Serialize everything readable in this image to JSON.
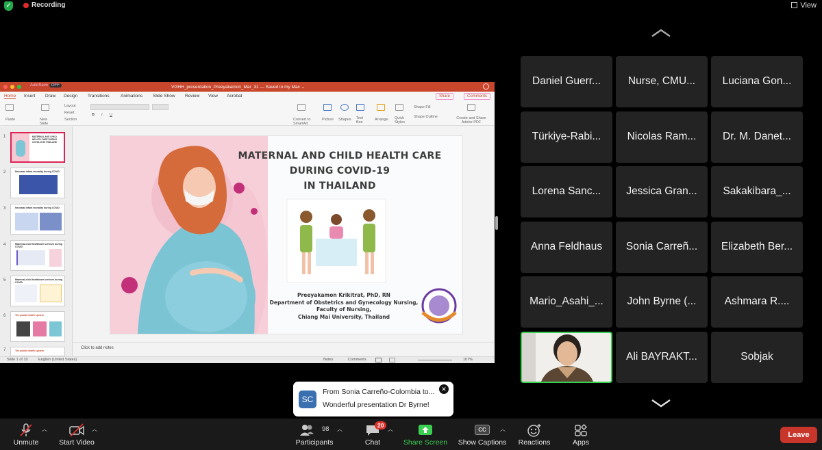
{
  "top_bar": {
    "recording_label": "Recording",
    "view_label": "View"
  },
  "shared_app": {
    "window_title": "VGHH_presentation_Preeyakamon_Mar_31 — Saved to my Mac ⌄",
    "autosave_label": "AutoSave",
    "autosave_state": "OFF",
    "ribbon_tabs": [
      "Home",
      "Insert",
      "Draw",
      "Design",
      "Transitions",
      "Animations",
      "Slide Show",
      "Review",
      "View",
      "Acrobat"
    ],
    "share_label": "Share",
    "comments_label": "Comments",
    "toolbar": {
      "paste": "Paste",
      "new_slide": "New Slide",
      "layout": "Layout",
      "reset": "Reset",
      "section": "Section",
      "convert_smartart": "Convert to SmartArt",
      "picture": "Picture",
      "shapes": "Shapes",
      "text_box": "Text Box",
      "arrange": "Arrange",
      "quick_styles": "Quick Styles",
      "shape_fill": "Shape Fill",
      "shape_outline": "Shape Outline",
      "create_share_pdf": "Create and Share Adobe PDF"
    },
    "thumbnails": [
      {
        "num": "1",
        "title": "MATERNAL AND CHILD HEALTH CARE DURING COVID-19 IN THAILAND"
      },
      {
        "num": "2",
        "title": "Neonatal infant mortality during COVID"
      },
      {
        "num": "3",
        "title": "Neonatal infant mortality during COVID"
      },
      {
        "num": "4",
        "title": "Maternal-child healthcare services during COVID"
      },
      {
        "num": "5",
        "title": "Maternal-child healthcare services during COVID"
      },
      {
        "num": "6",
        "title": "The public health system"
      },
      {
        "num": "7",
        "title": "The public health system"
      }
    ],
    "slide": {
      "title_line1": "MATERNAL AND CHILD HEALTH CARE",
      "title_line2": "DURING COVID-19",
      "title_line3": "IN THAILAND",
      "author": "Preeyakamon Krikitrat, PhD, RN",
      "dept": "Department of Obstetrics and Gynecology Nursing,",
      "faculty": "Faculty of Nursing,",
      "university": "Chiang Mai University, Thailand"
    },
    "notes_placeholder": "Click to add notes",
    "status": {
      "slide_of": "Slide 1 of 10",
      "language": "English (United States)",
      "notes": "Notes",
      "comments": "Comments",
      "zoom": "107%"
    }
  },
  "participants_gallery": [
    "Daniel Guerr...",
    "Nurse, CMU...",
    "Luciana Gon...",
    "Türkiye-Rabi...",
    "Nicolas Ram...",
    "Dr. M. Danet...",
    "Lorena Sanc...",
    "Jessica Gran...",
    "Sakakibara_...",
    "Anna Feldhaus",
    "Sonia Carreñ...",
    "Elizabeth Ber...",
    "Mario_Asahi_...",
    "John Byrne (...",
    "Ashmara R....",
    "",
    "Ali BAYRAKT...",
    "Sobjak"
  ],
  "chat_toast": {
    "avatar_initials": "SC",
    "from": "From Sonia Carreño-Colombia to...",
    "message": "Wonderful presentation Dr Byrne!"
  },
  "bottom_bar": {
    "unmute": "Unmute",
    "start_video": "Start Video",
    "participants": "Participants",
    "participant_count": "98",
    "chat": "Chat",
    "chat_badge": "20",
    "share_screen": "Share Screen",
    "show_captions": "Show Captions",
    "captions_icon_text": "CC",
    "reactions": "Reactions",
    "apps": "Apps",
    "leave": "Leave"
  },
  "colors": {
    "share_green": "#3bcf52",
    "leave_red": "#c8352b",
    "ppt_accent": "#c8462c",
    "recording_red": "#e02c2c"
  }
}
